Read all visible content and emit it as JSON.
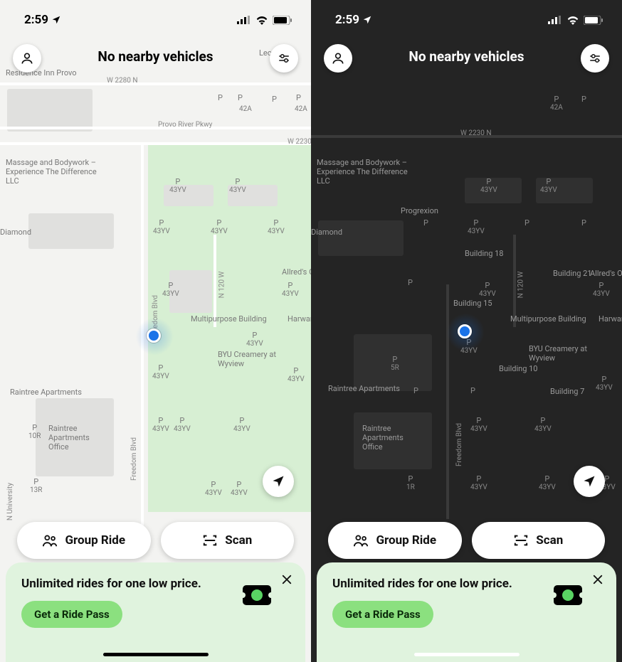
{
  "status": {
    "time": "2:59"
  },
  "title": "No nearby vehicles",
  "buttons": {
    "group_ride": "Group Ride",
    "scan": "Scan"
  },
  "promo": {
    "headline": "Unlimited rides for one low price.",
    "cta": "Get a Ride Pass"
  },
  "map": {
    "streets": {
      "w2280n": "W 2280 N",
      "w2230n": "W 2230 N",
      "provo_river_pkwy": "Provo River Pkwy",
      "freedom_blvd": "Freedom Blvd",
      "n120w": "N 120 W",
      "n_university": "N University"
    },
    "pois": {
      "residence_inn": "Residence Inn Provo",
      "leo_barth": "Leo Barth",
      "massage": "Massage and Bodywork – Experience The Difference LLC",
      "multipurpose": "Multipurpose Building",
      "byu_creamery": "BYU Creamery at Wyview",
      "raintree_apts": "Raintree Apartments",
      "raintree_office": "Raintree Apartments Office",
      "progrexion": "Progrexion",
      "harward": "Harward",
      "allreds": "Allred's O",
      "diamond": "Diamond",
      "b7": "Building 7",
      "b10": "Building 10",
      "b15": "Building 15",
      "b18": "Building 18",
      "b21": "Building 21"
    },
    "p": "P",
    "lots": {
      "l42a": "42A",
      "l43yv": "43YV",
      "l5r": "5R",
      "l10r": "10R",
      "l13r": "13R",
      "l1r": "1R"
    }
  }
}
